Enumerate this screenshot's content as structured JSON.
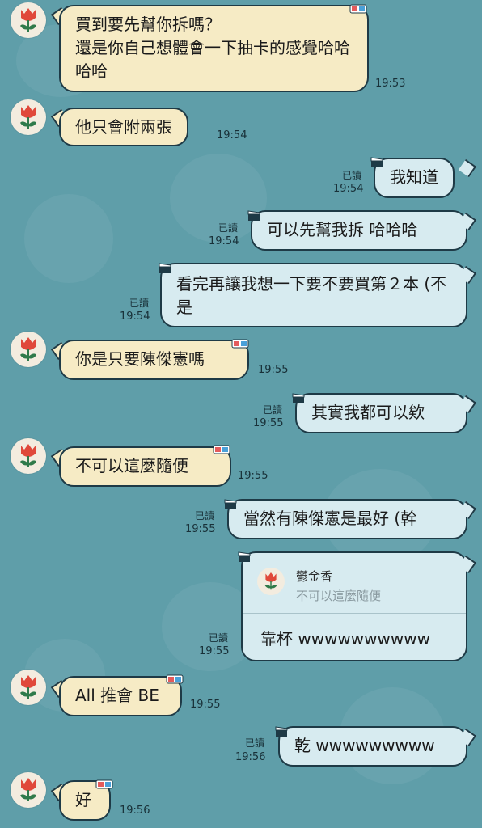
{
  "colors": {
    "background": "#5f9ea9",
    "incoming_bubble": "#f6ebc5",
    "outgoing_bubble": "#d7ebf0",
    "border": "#1e3a46"
  },
  "messages": [
    {
      "side": "in",
      "lines": [
        "買到要先幫你拆嗎？",
        "還是你自己想體會一下抽卡的感覺哈哈哈哈"
      ],
      "time": "19:53"
    },
    {
      "side": "in",
      "lines": [
        "他只會附兩張"
      ],
      "time": "19:54"
    },
    {
      "side": "out",
      "lines": [
        "我知道"
      ],
      "time": "19:54",
      "read": "已讀"
    },
    {
      "side": "out",
      "lines": [
        "可以先幫我拆 哈哈哈"
      ],
      "time": "19:54",
      "read": "已讀"
    },
    {
      "side": "out",
      "lines": [
        "看完再讓我想一下要不要買第２本 (不是"
      ],
      "time": "19:54",
      "read": "已讀"
    },
    {
      "side": "in",
      "lines": [
        "你是只要陳傑憲嗎"
      ],
      "time": "19:55"
    },
    {
      "side": "out",
      "lines": [
        "其實我都可以欸"
      ],
      "time": "19:55",
      "read": "已讀"
    },
    {
      "side": "in",
      "lines": [
        "不可以這麼隨便"
      ],
      "time": "19:55"
    },
    {
      "side": "out",
      "lines": [
        "當然有陳傑憲是最好 (幹"
      ],
      "time": "19:55",
      "read": "已讀"
    },
    {
      "side": "out",
      "reply": {
        "name": "鬱金香",
        "quote": "不可以這麼隨便"
      },
      "lines": [
        "靠杯 wwwwwwwwww"
      ],
      "time": "19:55",
      "read": "已讀"
    },
    {
      "side": "in",
      "lines": [
        "All 推會 BE"
      ],
      "time": "19:55"
    },
    {
      "side": "out",
      "lines": [
        "乾 wwwwwwwww"
      ],
      "time": "19:56",
      "read": "已讀"
    },
    {
      "side": "in",
      "lines": [
        "好"
      ],
      "time": "19:56"
    }
  ]
}
